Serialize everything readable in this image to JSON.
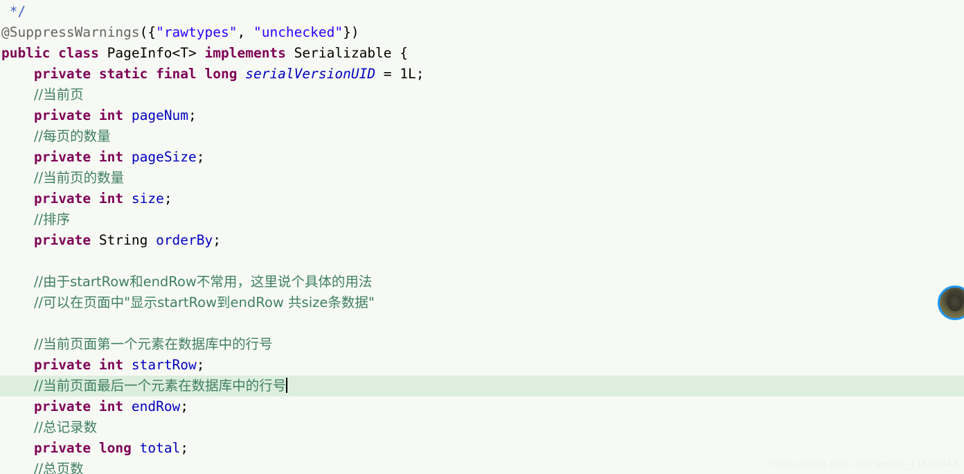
{
  "editor": {
    "language": "java",
    "background_color": "#f7faf4",
    "current_line_highlight_color": "#ddeede",
    "caret_color": "#000000",
    "colors": {
      "keyword": "#7f0055",
      "comment": "#3f7f5f",
      "javadoc": "#3f5fbf",
      "string": "#2a00ff",
      "field": "#0000c0",
      "static_field": "#0000c0",
      "annotation": "#646464",
      "plain": "#000000",
      "accent_avatar_ring": "#2196f3"
    }
  },
  "code": {
    "lines": [
      {
        "id": "line-javadoc-close",
        "current": false,
        "tokens": [
          {
            "cls": "tok-plain",
            "text": " "
          },
          {
            "cls": "tok-jdoc",
            "text": "*/"
          }
        ]
      },
      {
        "id": "line-suppresswarnings",
        "current": false,
        "tokens": [
          {
            "cls": "tok-annot",
            "text": "@SuppressWarnings"
          },
          {
            "cls": "tok-punct",
            "text": "({"
          },
          {
            "cls": "tok-string",
            "text": "\"rawtypes\""
          },
          {
            "cls": "tok-punct",
            "text": ", "
          },
          {
            "cls": "tok-string",
            "text": "\"unchecked\""
          },
          {
            "cls": "tok-punct",
            "text": "})"
          }
        ]
      },
      {
        "id": "line-class-decl",
        "current": false,
        "tokens": [
          {
            "cls": "tok-keyword",
            "text": "public class"
          },
          {
            "cls": "tok-plain",
            "text": " PageInfo<T> "
          },
          {
            "cls": "tok-keyword",
            "text": "implements"
          },
          {
            "cls": "tok-plain",
            "text": " Serializable {"
          }
        ]
      },
      {
        "id": "line-serialversionuid",
        "current": false,
        "tokens": [
          {
            "cls": "tok-plain",
            "text": "    "
          },
          {
            "cls": "tok-keyword",
            "text": "private static final long"
          },
          {
            "cls": "tok-plain",
            "text": " "
          },
          {
            "cls": "tok-static",
            "text": "serialVersionUID"
          },
          {
            "cls": "tok-plain",
            "text": " = 1L;"
          }
        ]
      },
      {
        "id": "line-comment-pagenum",
        "current": false,
        "tokens": [
          {
            "cls": "tok-plain",
            "text": "    "
          },
          {
            "cls": "tok-comment cjk",
            "text": "//当前页"
          }
        ]
      },
      {
        "id": "line-field-pagenum",
        "current": false,
        "tokens": [
          {
            "cls": "tok-plain",
            "text": "    "
          },
          {
            "cls": "tok-keyword",
            "text": "private int"
          },
          {
            "cls": "tok-plain",
            "text": " "
          },
          {
            "cls": "tok-field",
            "text": "pageNum"
          },
          {
            "cls": "tok-plain",
            "text": ";"
          }
        ]
      },
      {
        "id": "line-comment-pagesize",
        "current": false,
        "tokens": [
          {
            "cls": "tok-plain",
            "text": "    "
          },
          {
            "cls": "tok-comment cjk",
            "text": "//每页的数量"
          }
        ]
      },
      {
        "id": "line-field-pagesize",
        "current": false,
        "tokens": [
          {
            "cls": "tok-plain",
            "text": "    "
          },
          {
            "cls": "tok-keyword",
            "text": "private int"
          },
          {
            "cls": "tok-plain",
            "text": " "
          },
          {
            "cls": "tok-field",
            "text": "pageSize"
          },
          {
            "cls": "tok-plain",
            "text": ";"
          }
        ]
      },
      {
        "id": "line-comment-size",
        "current": false,
        "tokens": [
          {
            "cls": "tok-plain",
            "text": "    "
          },
          {
            "cls": "tok-comment cjk",
            "text": "//当前页的数量"
          }
        ]
      },
      {
        "id": "line-field-size",
        "current": false,
        "tokens": [
          {
            "cls": "tok-plain",
            "text": "    "
          },
          {
            "cls": "tok-keyword",
            "text": "private int"
          },
          {
            "cls": "tok-plain",
            "text": " "
          },
          {
            "cls": "tok-field",
            "text": "size"
          },
          {
            "cls": "tok-plain",
            "text": ";"
          }
        ]
      },
      {
        "id": "line-comment-orderby",
        "current": false,
        "tokens": [
          {
            "cls": "tok-plain",
            "text": "    "
          },
          {
            "cls": "tok-comment cjk",
            "text": "//排序"
          }
        ]
      },
      {
        "id": "line-field-orderby",
        "current": false,
        "tokens": [
          {
            "cls": "tok-plain",
            "text": "    "
          },
          {
            "cls": "tok-keyword",
            "text": "private"
          },
          {
            "cls": "tok-plain",
            "text": " String "
          },
          {
            "cls": "tok-field",
            "text": "orderBy"
          },
          {
            "cls": "tok-plain",
            "text": ";"
          }
        ]
      },
      {
        "id": "line-blank-1",
        "current": false,
        "tokens": [
          {
            "cls": "tok-plain",
            "text": " "
          }
        ]
      },
      {
        "id": "line-comment-startrow-endrow-note",
        "current": false,
        "tokens": [
          {
            "cls": "tok-plain",
            "text": "    "
          },
          {
            "cls": "tok-comment cjk",
            "text": "//由于startRow和endRow不常用，这里说个具体的用法"
          }
        ]
      },
      {
        "id": "line-comment-page-display-note",
        "current": false,
        "tokens": [
          {
            "cls": "tok-plain",
            "text": "    "
          },
          {
            "cls": "tok-comment cjk",
            "text": "//可以在页面中\"显示startRow到endRow 共size条数据\""
          }
        ]
      },
      {
        "id": "line-blank-2",
        "current": false,
        "tokens": [
          {
            "cls": "tok-plain",
            "text": " "
          }
        ]
      },
      {
        "id": "line-comment-startrow",
        "current": false,
        "tokens": [
          {
            "cls": "tok-plain",
            "text": "    "
          },
          {
            "cls": "tok-comment cjk",
            "text": "//当前页面第一个元素在数据库中的行号"
          }
        ]
      },
      {
        "id": "line-field-startrow",
        "current": false,
        "tokens": [
          {
            "cls": "tok-plain",
            "text": "    "
          },
          {
            "cls": "tok-keyword",
            "text": "private int"
          },
          {
            "cls": "tok-plain",
            "text": " "
          },
          {
            "cls": "tok-field",
            "text": "startRow"
          },
          {
            "cls": "tok-plain",
            "text": ";"
          }
        ]
      },
      {
        "id": "line-comment-endrow",
        "current": true,
        "caret": true,
        "tokens": [
          {
            "cls": "tok-plain",
            "text": "    "
          },
          {
            "cls": "tok-comment cjk",
            "text": "//当前页面最后一个元素在数据库中的行号"
          }
        ]
      },
      {
        "id": "line-field-endrow",
        "current": false,
        "tokens": [
          {
            "cls": "tok-plain",
            "text": "    "
          },
          {
            "cls": "tok-keyword",
            "text": "private int"
          },
          {
            "cls": "tok-plain",
            "text": " "
          },
          {
            "cls": "tok-field",
            "text": "endRow"
          },
          {
            "cls": "tok-plain",
            "text": ";"
          }
        ]
      },
      {
        "id": "line-comment-total",
        "current": false,
        "tokens": [
          {
            "cls": "tok-plain",
            "text": "    "
          },
          {
            "cls": "tok-comment cjk",
            "text": "//总记录数"
          }
        ]
      },
      {
        "id": "line-field-total",
        "current": false,
        "tokens": [
          {
            "cls": "tok-plain",
            "text": "    "
          },
          {
            "cls": "tok-keyword",
            "text": "private long"
          },
          {
            "cls": "tok-plain",
            "text": " "
          },
          {
            "cls": "tok-field",
            "text": "total"
          },
          {
            "cls": "tok-plain",
            "text": ";"
          }
        ]
      },
      {
        "id": "line-comment-pages",
        "current": false,
        "tokens": [
          {
            "cls": "tok-plain",
            "text": "    "
          },
          {
            "cls": "tok-comment cjk",
            "text": "//总页数"
          }
        ]
      }
    ]
  },
  "overlay": {
    "watermark_text": "https://blog.csdn.net/weixin_41660948",
    "avatar_label": "user-avatar"
  }
}
